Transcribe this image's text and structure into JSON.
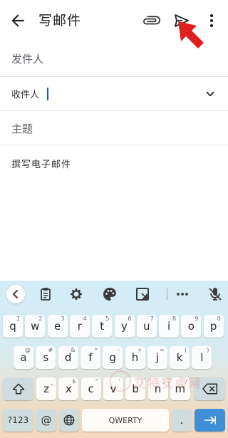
{
  "appbar": {
    "title": "写邮件",
    "icons": {
      "back": "arrow-back-icon",
      "attach": "paperclip-icon",
      "send": "send-icon",
      "more": "more-vert-icon"
    },
    "highlight_color": "#e02020"
  },
  "compose": {
    "from_label": "发件人",
    "to_label": "收件人",
    "subject_label": "主题",
    "body_placeholder": "撰写电子邮件"
  },
  "keyboard": {
    "toolbar_icons": [
      "chevron-left-icon",
      "clipboard-icon",
      "gear-icon",
      "palette-icon",
      "resize-icon",
      "more-horiz-icon",
      "mic-off-icon"
    ],
    "row1": [
      {
        "k": "q",
        "h": "1"
      },
      {
        "k": "w",
        "h": "2"
      },
      {
        "k": "e",
        "h": "3"
      },
      {
        "k": "r",
        "h": "4"
      },
      {
        "k": "t",
        "h": "5"
      },
      {
        "k": "y",
        "h": "6"
      },
      {
        "k": "u",
        "h": "7"
      },
      {
        "k": "i",
        "h": "8"
      },
      {
        "k": "o",
        "h": "9"
      },
      {
        "k": "p",
        "h": "0"
      }
    ],
    "row2": [
      {
        "k": "a",
        "h": "@"
      },
      {
        "k": "s",
        "h": "#"
      },
      {
        "k": "d",
        "h": "&"
      },
      {
        "k": "f",
        "h": "*"
      },
      {
        "k": "g",
        "h": "-"
      },
      {
        "k": "h",
        "h": "+"
      },
      {
        "k": "j",
        "h": "="
      },
      {
        "k": "k",
        "h": "("
      },
      {
        "k": "l",
        "h": ")"
      }
    ],
    "row3": [
      {
        "k": "z",
        "h": "_"
      },
      {
        "k": "x",
        "h": "$"
      },
      {
        "k": "c",
        "h": "\""
      },
      {
        "k": "v",
        "h": "'"
      },
      {
        "k": "b",
        "h": ":"
      },
      {
        "k": "n",
        "h": ";"
      },
      {
        "k": "m",
        "h": "/"
      }
    ],
    "symbols_label": "?123",
    "at_label": "@",
    "space_label": "QWERTY",
    "period_label": ".",
    "enter_color": "#3e8fd6"
  },
  "watermark": "艾特安卓网"
}
